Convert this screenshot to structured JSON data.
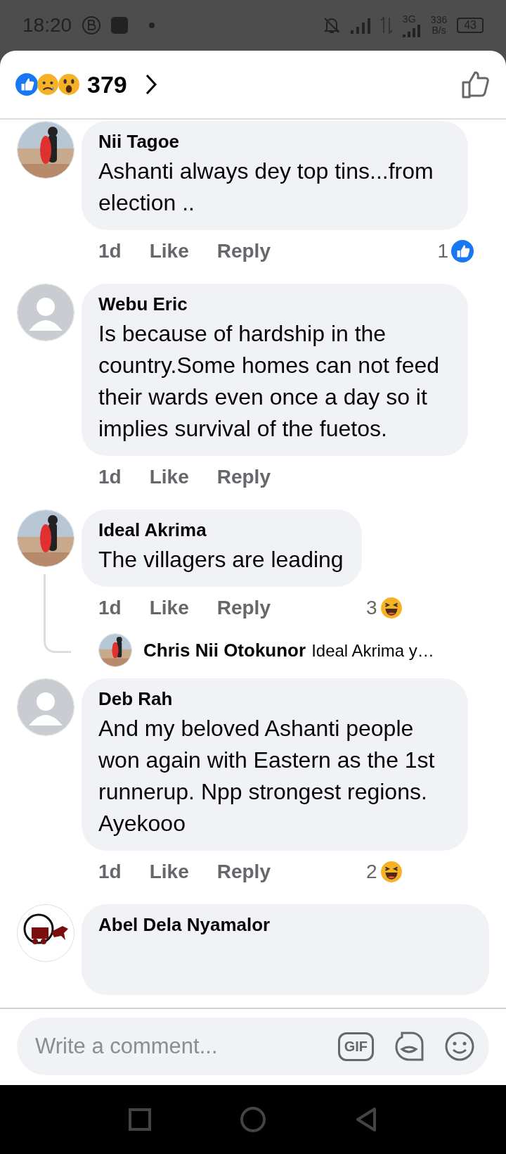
{
  "status_bar": {
    "time": "18:20",
    "network": "3G",
    "speed_value": "336",
    "speed_unit": "B/s",
    "battery": "43"
  },
  "header": {
    "reactions": [
      {
        "kind": "like"
      },
      {
        "kind": "sad"
      },
      {
        "kind": "wow"
      }
    ],
    "count": "379"
  },
  "comments": [
    {
      "name": "Nii Tagoe",
      "text": "Ashanti always dey top tins...from election ..",
      "time": "1d",
      "like": "Like",
      "reply": "Reply",
      "reaction": {
        "kind": "like",
        "count": "1"
      }
    },
    {
      "name": "Webu Eric",
      "text": "Is because of hardship in the country.Some homes can not feed their wards even once a day so it implies survival of the fuetos.",
      "avatar": {
        "kind": "default"
      },
      "time": "1d",
      "like": "Like",
      "reply": "Reply"
    },
    {
      "name": "Ideal Akrima",
      "text": "The villagers are leading",
      "time": "1d",
      "like": "Like",
      "reply": "Reply",
      "reaction": {
        "kind": "haha",
        "count": "3"
      },
      "replies": [
        {
          "name": "Chris Nii Otokunor",
          "text": "Ideal Akrima y…"
        }
      ]
    },
    {
      "name": "Deb Rah",
      "text": "And my beloved Ashanti people won again with Eastern as the 1st runnerup. Npp strongest regions. Ayekooo",
      "avatar": {
        "kind": "default"
      },
      "time": "1d",
      "like": "Like",
      "reply": "Reply",
      "reaction": {
        "kind": "haha",
        "count": "2"
      }
    },
    {
      "name": "Abel Dela Nyamalor",
      "avatar": {
        "kind": "logo"
      }
    }
  ],
  "composer": {
    "placeholder": "Write a comment...",
    "gif_label": "GIF"
  }
}
